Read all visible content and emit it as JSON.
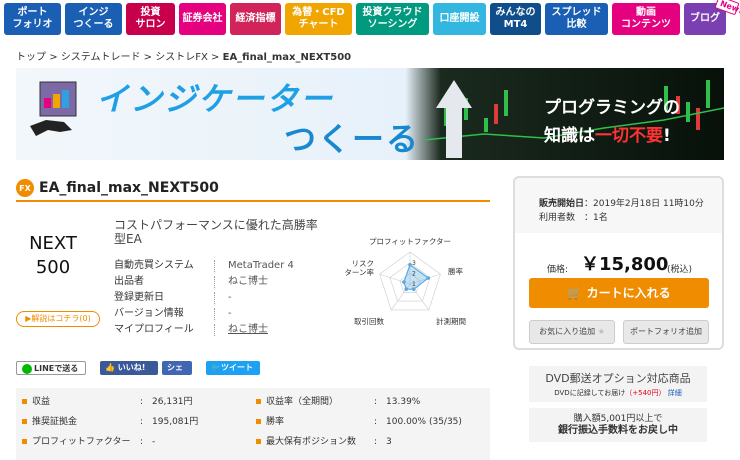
{
  "nav": [
    {
      "label": "ポート\nフォリオ",
      "color": "#1a5fb4"
    },
    {
      "label": "インジ\nつくーる",
      "color": "#1a5fb4"
    },
    {
      "label": "投資\nサロン",
      "color": "#c8004b"
    },
    {
      "label": "証券会社",
      "color": "#e4007f"
    },
    {
      "label": "経済指標",
      "color": "#d0245a"
    },
    {
      "label": "為替・CFD\nチャート",
      "color": "#f0a500"
    },
    {
      "label": "投資クラウド\nソーシング",
      "color": "#009a7e"
    },
    {
      "label": "口座開設",
      "color": "#33b6e0"
    },
    {
      "label": "みんなの\nMT4",
      "color": "#0f4e8a"
    },
    {
      "label": "スプレッド\n比較",
      "color": "#1a5fb4"
    },
    {
      "label": "動画\nコンテンツ",
      "color": "#e4007f"
    },
    {
      "label": "ブログ",
      "color": "#7a3fb0"
    }
  ],
  "nav_badge": "New!",
  "breadcrumb": {
    "items": [
      "トップ",
      "システムトレード",
      "シストレFX"
    ],
    "current": "EA_final_max_NEXT500",
    "separator": ">"
  },
  "banner": {
    "title1": "インジケーター",
    "title2": "つくーる",
    "sub1": "プログラミングの",
    "sub2_a": "知識は",
    "sub2_b": "一切不要",
    "sub2_c": "!"
  },
  "product": {
    "badge": "FX",
    "title": "EA_final_max_NEXT500",
    "logo_line1": "NEXT",
    "logo_line2": "500",
    "detail_button": "▶解説はコチラ(0)",
    "description": "コストパフォーマンスに優れた高勝率型EA",
    "info": [
      {
        "key": "自動売買システム",
        "value": "MetaTrader 4"
      },
      {
        "key": "出品者",
        "value": "ねこ博士"
      },
      {
        "key": "登録更新日",
        "value": "-"
      },
      {
        "key": "バージョン情報",
        "value": "-"
      },
      {
        "key": "マイプロフィール",
        "value": "ねこ博士"
      }
    ]
  },
  "radar": {
    "labels": [
      "プロフィットファクター",
      "勝率",
      "計測期間",
      "取引回数",
      "リスク\nターン率"
    ],
    "values": [
      3,
      3,
      1,
      1,
      1
    ],
    "scale_labels": [
      "3",
      "2",
      "1"
    ],
    "max": 5,
    "color": "#5aa8e0"
  },
  "social": {
    "line": "LINEで送る",
    "like": "いいね! 0",
    "share": "シェア",
    "tweet": "ツイート"
  },
  "stats": [
    {
      "key": "収益",
      "value": "26,131円"
    },
    {
      "key": "収益率（全期間）",
      "value": "13.39%"
    },
    {
      "key": "推奨証拠金",
      "value": "195,081円"
    },
    {
      "key": "勝率",
      "value": "100.00% (35/35)"
    },
    {
      "key": "プロフィットファクター",
      "value": "-"
    },
    {
      "key": "最大保有ポジション数",
      "value": "3"
    }
  ],
  "side": {
    "sale_start_label": "販売開始日",
    "sale_start_value": "2019年2月18日 11時10分",
    "users_label": "利用者数",
    "users_value": "1名",
    "price_label": "価格:",
    "price_value": "￥15,800",
    "price_tax": "(税込)",
    "cart_button": "カートに入れる",
    "favorite_button": "お気に入り追加",
    "portfolio_button": "ポートフォリオ追加",
    "dvd_title": "DVD郵送オプション対応商品",
    "dvd_sub_a": "DVDに記録してお届け",
    "dvd_sub_price": "（+540円）",
    "dvd_sub_link": "詳細",
    "bank_line1": "購入額5,001円以上で",
    "bank_line2": "銀行振込手数料をお戻し中"
  }
}
